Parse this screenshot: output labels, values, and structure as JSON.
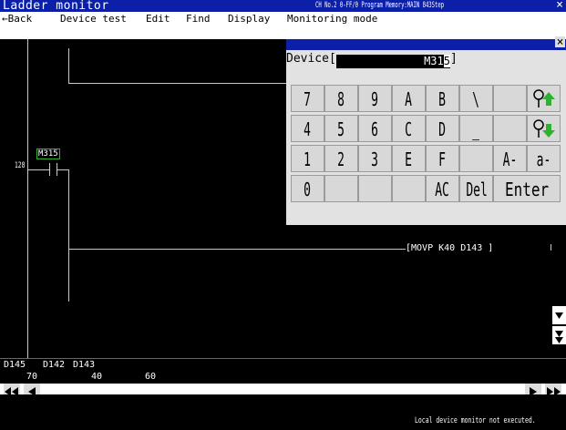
{
  "titlebar": {
    "app_title": "Ladder monitor",
    "status": "CH No.2 0-FF/0 Program Memory:MAIN          843Step",
    "close": "×"
  },
  "menu": {
    "back": "←Back",
    "device_test": "Device test",
    "edit": "Edit",
    "find": "Find",
    "display": "Display",
    "monitoring_mode": "Monitoring mode"
  },
  "ladder": {
    "step_number": "128",
    "contact_device": "M315",
    "instruction": "[MOVP   K40    D143    ]"
  },
  "device_values": {
    "labels": [
      "D145",
      "D142",
      "D143"
    ],
    "values": [
      "70",
      "40",
      "60"
    ]
  },
  "statusbar": {
    "message": "Local device monitor not executed."
  },
  "keypad": {
    "close": "×",
    "device_label": "Device[",
    "device_value": "M31",
    "device_cursor": "5",
    "device_close": "]",
    "rows": [
      [
        "7",
        "8",
        "9",
        "A",
        "B",
        "\\",
        "",
        "up"
      ],
      [
        "4",
        "5",
        "6",
        "C",
        "D",
        "_",
        "",
        "down"
      ],
      [
        "1",
        "2",
        "3",
        "E",
        "F",
        "",
        "A-Z",
        "a-z"
      ],
      [
        "0",
        "",
        "",
        "",
        "AC",
        "Del",
        "Enter"
      ]
    ],
    "r0": {
      "k0": "7",
      "k1": "8",
      "k2": "9",
      "k3": "A",
      "k4": "B",
      "k5": "\\"
    },
    "r1": {
      "k0": "4",
      "k1": "5",
      "k2": "6",
      "k3": "C",
      "k4": "D",
      "k5": "_"
    },
    "r2": {
      "k0": "1",
      "k1": "2",
      "k2": "3",
      "k3": "E",
      "k4": "F",
      "k6": "A-Z",
      "k7": "a-z"
    },
    "r3": {
      "k0": "0",
      "k4": "AC",
      "k5": "Del",
      "k6": "Enter"
    },
    "icons": {
      "search_up": "search-up-icon",
      "search_down": "search-down-icon"
    }
  },
  "colors": {
    "title_bar": "#0b1fa8",
    "contact_box": "#2fb12f",
    "search_arrow": "#2fb12f"
  }
}
